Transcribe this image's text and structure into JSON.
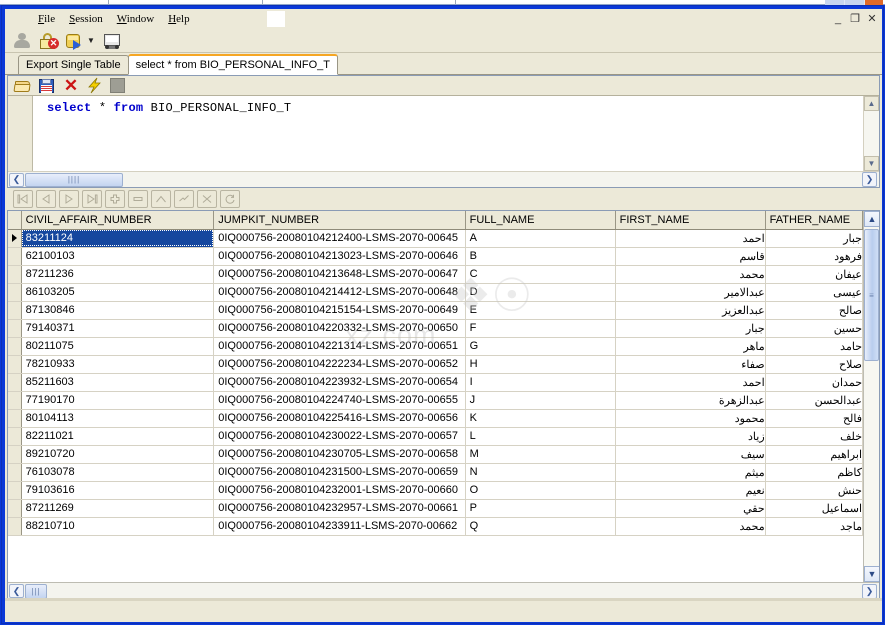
{
  "window": {
    "sys_buttons": [
      {
        "name": "minimize",
        "glyph": "_"
      },
      {
        "name": "restore",
        "glyph": "❐"
      },
      {
        "name": "close",
        "glyph": "✕"
      }
    ]
  },
  "menubar": {
    "items": [
      {
        "name": "file",
        "pre": "F",
        "rest": "ile"
      },
      {
        "name": "session",
        "pre": "S",
        "rest": "ession"
      },
      {
        "name": "window",
        "pre": "W",
        "rest": "indow"
      },
      {
        "name": "help",
        "pre": "H",
        "rest": "elp"
      }
    ]
  },
  "main_toolbar": {
    "icons": [
      "user-icon",
      "disconnect-lock-icon",
      "database-connect-icon",
      "sql-console-icon"
    ]
  },
  "tabs": [
    {
      "name": "tab-export-single-table",
      "label": "Export Single Table",
      "active": false
    },
    {
      "name": "tab-sql-query",
      "label": "select * from BIO_PERSONAL_INFO_T",
      "active": true
    }
  ],
  "sql_toolbar": {
    "icons": [
      "open-folder-icon",
      "save-icon",
      "clear-icon",
      "execute-icon",
      "stop-icon"
    ]
  },
  "sql_editor": {
    "keyword_1": "select",
    "star": " * ",
    "keyword_2": "from",
    "table": " BIO_PERSONAL_INFO_T",
    "full_text": "select * from BIO_PERSONAL_INFO_T"
  },
  "navigator": {
    "buttons": [
      {
        "name": "nav-first",
        "icon": "first-record-icon"
      },
      {
        "name": "nav-prior",
        "icon": "prior-record-icon"
      },
      {
        "name": "nav-next",
        "icon": "next-record-icon"
      },
      {
        "name": "nav-last",
        "icon": "last-record-icon"
      },
      {
        "name": "nav-insert",
        "icon": "insert-record-icon"
      },
      {
        "name": "nav-delete",
        "icon": "delete-record-icon"
      },
      {
        "name": "nav-edit",
        "icon": "edit-record-icon"
      },
      {
        "name": "nav-post",
        "icon": "post-edit-icon"
      },
      {
        "name": "nav-cancel",
        "icon": "cancel-edit-icon"
      },
      {
        "name": "nav-refresh",
        "icon": "refresh-icon"
      }
    ]
  },
  "grid": {
    "columns": [
      "CIVIL_AFFAIR_NUMBER",
      "JUMPKIT_NUMBER",
      "FULL_NAME",
      "FIRST_NAME",
      "FATHER_NAME"
    ],
    "selected_row_index": 0,
    "rows": [
      [
        "83211124",
        "0IQ000756-20080104212400-LSMS-2070-00645",
        "A",
        "احمد",
        "جبار"
      ],
      [
        "62100103",
        "0IQ000756-20080104213023-LSMS-2070-00646",
        "B",
        "قاسم",
        "فرهود"
      ],
      [
        "87211236",
        "0IQ000756-20080104213648-LSMS-2070-00647",
        "C",
        "محمد",
        "عيفان"
      ],
      [
        "86103205",
        "0IQ000756-20080104214412-LSMS-2070-00648",
        "D",
        "عبدالامير",
        "عيسى"
      ],
      [
        "87130846",
        "0IQ000756-20080104215154-LSMS-2070-00649",
        "E",
        "عبدالعزيز",
        "صالح"
      ],
      [
        "79140371",
        "0IQ000756-20080104220332-LSMS-2070-00650",
        "F",
        "جبار",
        "حسين"
      ],
      [
        "80211075",
        "0IQ000756-20080104221314-LSMS-2070-00651",
        "G",
        "ماهر",
        "حامد"
      ],
      [
        "78210933",
        "0IQ000756-20080104222234-LSMS-2070-00652",
        "H",
        "صفاء",
        "صلاح"
      ],
      [
        "85211603",
        "0IQ000756-20080104223932-LSMS-2070-00654",
        "I",
        "احمد",
        "حمدان"
      ],
      [
        "77190170",
        "0IQ000756-20080104224740-LSMS-2070-00655",
        "J",
        "عبدالزهرة",
        "عبدالحسن"
      ],
      [
        "80104113",
        "0IQ000756-20080104225416-LSMS-2070-00656",
        "K",
        "محمود",
        "فالح"
      ],
      [
        "82211021",
        "0IQ000756-20080104230022-LSMS-2070-00657",
        "L",
        "زياد",
        "خلف"
      ],
      [
        "89210720",
        "0IQ000756-20080104230705-LSMS-2070-00658",
        "M",
        "سيف",
        "ابراهيم"
      ],
      [
        "76103078",
        "0IQ000756-20080104231500-LSMS-2070-00659",
        "N",
        "ميثم",
        "كاظم"
      ],
      [
        "79103616",
        "0IQ000756-20080104232001-LSMS-2070-00660",
        "O",
        "نعيم",
        "حنش"
      ],
      [
        "87211269",
        "0IQ000756-20080104232957-LSMS-2070-00661",
        "P",
        "حقي",
        "اسماعيل"
      ],
      [
        "88210710",
        "0IQ000756-20080104233911-LSMS-2070-00662",
        "Q",
        "محمد",
        "ماجد"
      ]
    ]
  },
  "watermark": {
    "text": "xz.com"
  },
  "colors": {
    "window_border": "#0a38d8",
    "face": "#ece9d8",
    "selection": "#15479e",
    "sql_keyword": "#0000cc",
    "tab_accent": "#f5a623"
  }
}
